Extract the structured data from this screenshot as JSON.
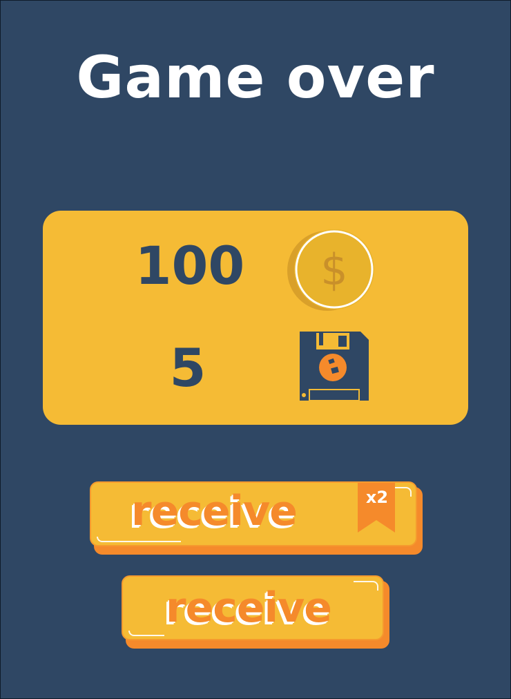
{
  "title": "Game over",
  "rewards": {
    "coins": {
      "value": "100",
      "icon": "coin-icon"
    },
    "disks": {
      "value": "5",
      "icon": "floppy-disk-icon"
    }
  },
  "buttons": {
    "receive_x2": {
      "label": "receive",
      "badge": "x2"
    },
    "receive": {
      "label": "receive"
    }
  },
  "colors": {
    "background": "#2f4764",
    "panel": "#f5bb35",
    "accent_orange": "#f58a2b",
    "text_dark": "#2f4764",
    "white": "#ffffff"
  }
}
